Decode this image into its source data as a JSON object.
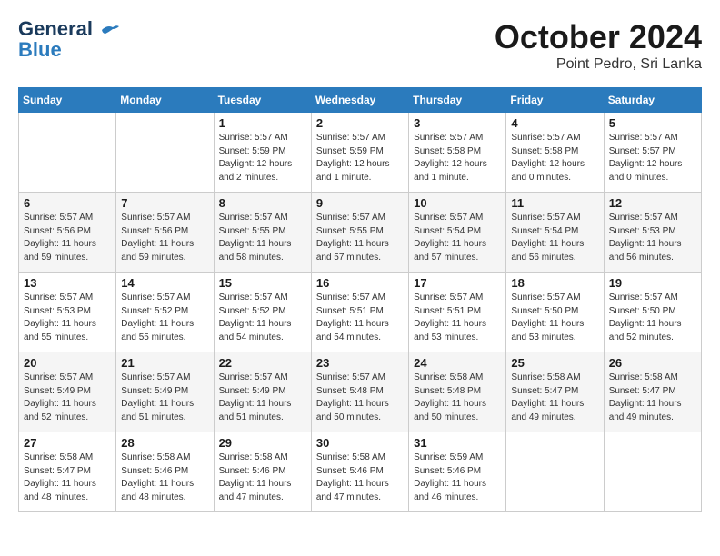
{
  "header": {
    "logo": {
      "line1": "General",
      "line2": "Blue"
    },
    "title": "October 2024",
    "location": "Point Pedro, Sri Lanka"
  },
  "weekdays": [
    "Sunday",
    "Monday",
    "Tuesday",
    "Wednesday",
    "Thursday",
    "Friday",
    "Saturday"
  ],
  "weeks": [
    [
      {
        "day": "",
        "info": ""
      },
      {
        "day": "",
        "info": ""
      },
      {
        "day": "1",
        "info": "Sunrise: 5:57 AM\nSunset: 5:59 PM\nDaylight: 12 hours\nand 2 minutes."
      },
      {
        "day": "2",
        "info": "Sunrise: 5:57 AM\nSunset: 5:59 PM\nDaylight: 12 hours\nand 1 minute."
      },
      {
        "day": "3",
        "info": "Sunrise: 5:57 AM\nSunset: 5:58 PM\nDaylight: 12 hours\nand 1 minute."
      },
      {
        "day": "4",
        "info": "Sunrise: 5:57 AM\nSunset: 5:58 PM\nDaylight: 12 hours\nand 0 minutes."
      },
      {
        "day": "5",
        "info": "Sunrise: 5:57 AM\nSunset: 5:57 PM\nDaylight: 12 hours\nand 0 minutes."
      }
    ],
    [
      {
        "day": "6",
        "info": "Sunrise: 5:57 AM\nSunset: 5:56 PM\nDaylight: 11 hours\nand 59 minutes."
      },
      {
        "day": "7",
        "info": "Sunrise: 5:57 AM\nSunset: 5:56 PM\nDaylight: 11 hours\nand 59 minutes."
      },
      {
        "day": "8",
        "info": "Sunrise: 5:57 AM\nSunset: 5:55 PM\nDaylight: 11 hours\nand 58 minutes."
      },
      {
        "day": "9",
        "info": "Sunrise: 5:57 AM\nSunset: 5:55 PM\nDaylight: 11 hours\nand 57 minutes."
      },
      {
        "day": "10",
        "info": "Sunrise: 5:57 AM\nSunset: 5:54 PM\nDaylight: 11 hours\nand 57 minutes."
      },
      {
        "day": "11",
        "info": "Sunrise: 5:57 AM\nSunset: 5:54 PM\nDaylight: 11 hours\nand 56 minutes."
      },
      {
        "day": "12",
        "info": "Sunrise: 5:57 AM\nSunset: 5:53 PM\nDaylight: 11 hours\nand 56 minutes."
      }
    ],
    [
      {
        "day": "13",
        "info": "Sunrise: 5:57 AM\nSunset: 5:53 PM\nDaylight: 11 hours\nand 55 minutes."
      },
      {
        "day": "14",
        "info": "Sunrise: 5:57 AM\nSunset: 5:52 PM\nDaylight: 11 hours\nand 55 minutes."
      },
      {
        "day": "15",
        "info": "Sunrise: 5:57 AM\nSunset: 5:52 PM\nDaylight: 11 hours\nand 54 minutes."
      },
      {
        "day": "16",
        "info": "Sunrise: 5:57 AM\nSunset: 5:51 PM\nDaylight: 11 hours\nand 54 minutes."
      },
      {
        "day": "17",
        "info": "Sunrise: 5:57 AM\nSunset: 5:51 PM\nDaylight: 11 hours\nand 53 minutes."
      },
      {
        "day": "18",
        "info": "Sunrise: 5:57 AM\nSunset: 5:50 PM\nDaylight: 11 hours\nand 53 minutes."
      },
      {
        "day": "19",
        "info": "Sunrise: 5:57 AM\nSunset: 5:50 PM\nDaylight: 11 hours\nand 52 minutes."
      }
    ],
    [
      {
        "day": "20",
        "info": "Sunrise: 5:57 AM\nSunset: 5:49 PM\nDaylight: 11 hours\nand 52 minutes."
      },
      {
        "day": "21",
        "info": "Sunrise: 5:57 AM\nSunset: 5:49 PM\nDaylight: 11 hours\nand 51 minutes."
      },
      {
        "day": "22",
        "info": "Sunrise: 5:57 AM\nSunset: 5:49 PM\nDaylight: 11 hours\nand 51 minutes."
      },
      {
        "day": "23",
        "info": "Sunrise: 5:57 AM\nSunset: 5:48 PM\nDaylight: 11 hours\nand 50 minutes."
      },
      {
        "day": "24",
        "info": "Sunrise: 5:58 AM\nSunset: 5:48 PM\nDaylight: 11 hours\nand 50 minutes."
      },
      {
        "day": "25",
        "info": "Sunrise: 5:58 AM\nSunset: 5:47 PM\nDaylight: 11 hours\nand 49 minutes."
      },
      {
        "day": "26",
        "info": "Sunrise: 5:58 AM\nSunset: 5:47 PM\nDaylight: 11 hours\nand 49 minutes."
      }
    ],
    [
      {
        "day": "27",
        "info": "Sunrise: 5:58 AM\nSunset: 5:47 PM\nDaylight: 11 hours\nand 48 minutes."
      },
      {
        "day": "28",
        "info": "Sunrise: 5:58 AM\nSunset: 5:46 PM\nDaylight: 11 hours\nand 48 minutes."
      },
      {
        "day": "29",
        "info": "Sunrise: 5:58 AM\nSunset: 5:46 PM\nDaylight: 11 hours\nand 47 minutes."
      },
      {
        "day": "30",
        "info": "Sunrise: 5:58 AM\nSunset: 5:46 PM\nDaylight: 11 hours\nand 47 minutes."
      },
      {
        "day": "31",
        "info": "Sunrise: 5:59 AM\nSunset: 5:46 PM\nDaylight: 11 hours\nand 46 minutes."
      },
      {
        "day": "",
        "info": ""
      },
      {
        "day": "",
        "info": ""
      }
    ]
  ]
}
